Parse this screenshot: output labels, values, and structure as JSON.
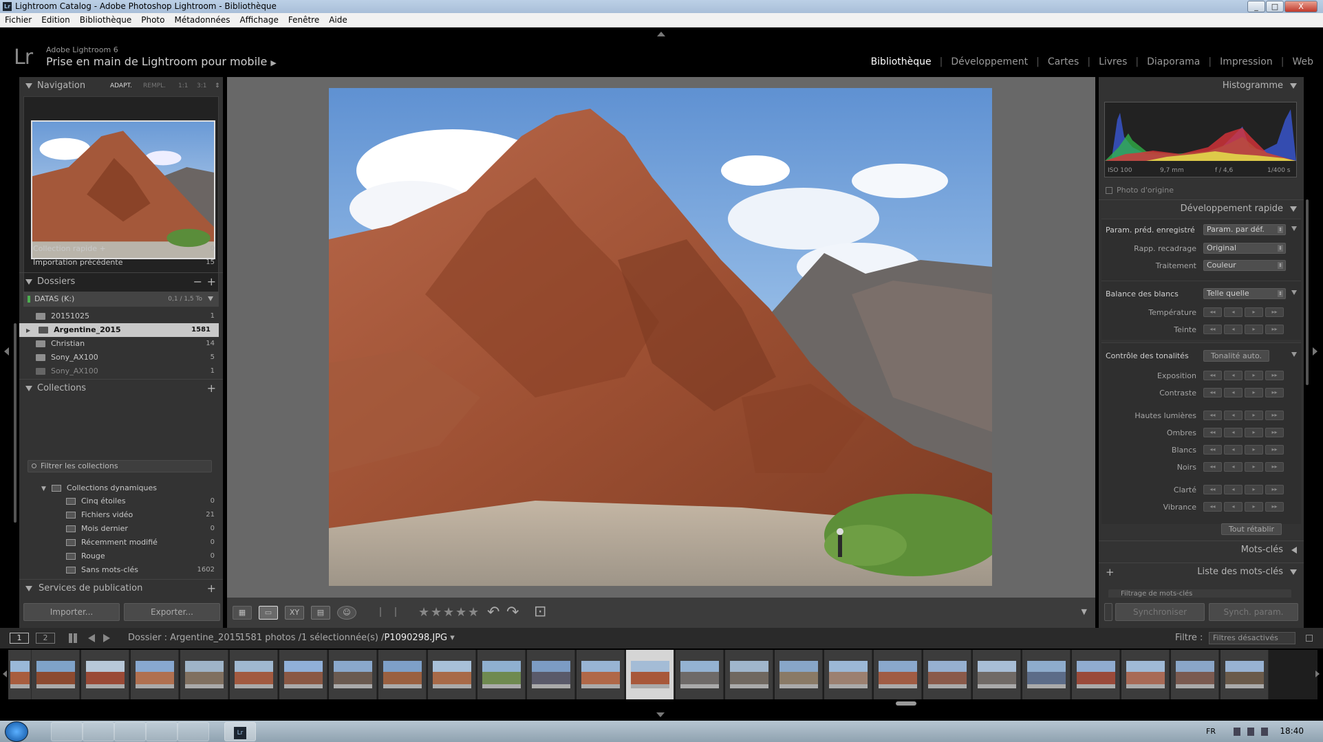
{
  "window": {
    "title": "Lightroom Catalog - Adobe Photoshop Lightroom - Bibliothèque",
    "lr_icon_text": "Lr",
    "min": "_",
    "max": "□",
    "close": "X"
  },
  "menu": [
    "Fichier",
    "Edition",
    "Bibliothèque",
    "Photo",
    "Métadonnées",
    "Affichage",
    "Fenêtre",
    "Aide"
  ],
  "identity": {
    "logo": "Lr",
    "version": "Adobe Lightroom 6",
    "title": "Prise en main de Lightroom pour mobile",
    "title_arrow": "▶"
  },
  "modules": [
    "Bibliothèque",
    "Développement",
    "Cartes",
    "Livres",
    "Diaporama",
    "Impression",
    "Web"
  ],
  "navigation": {
    "title": "Navigation",
    "zoom": [
      "ADAPT.",
      "REMPL.",
      "1:1",
      "3:1"
    ],
    "zoom_arrows": "⇕"
  },
  "catalog": [
    {
      "label": "Collection rapide +",
      "count": "0"
    },
    {
      "label": "Importation précédente",
      "count": "15"
    }
  ],
  "folders": {
    "title": "Dossiers",
    "minus": "−",
    "plus": "+",
    "volume": {
      "name": "DATAS (K:)",
      "space": "0,1 / 1,5 To"
    },
    "items": [
      {
        "label": "20151025",
        "count": "1"
      },
      {
        "label": "Argentine_2015",
        "count": "1581"
      },
      {
        "label": "Christian",
        "count": "14"
      },
      {
        "label": "Sony_AX100",
        "count": "5"
      },
      {
        "label": "Sony_AX100",
        "count": "1"
      }
    ]
  },
  "collections": {
    "title": "Collections",
    "plus": "+",
    "filter_placeholder": "Filtrer les collections",
    "group": "Collections dynamiques",
    "items": [
      {
        "label": "Cinq étoiles",
        "count": "0"
      },
      {
        "label": "Fichiers vidéo",
        "count": "21"
      },
      {
        "label": "Mois dernier",
        "count": "0"
      },
      {
        "label": "Récemment modifié",
        "count": "0"
      },
      {
        "label": "Rouge",
        "count": "0"
      },
      {
        "label": "Sans mots-clés",
        "count": "1602"
      }
    ]
  },
  "publish": {
    "title": "Services de publication",
    "plus": "+"
  },
  "left_buttons": {
    "import": "Importer...",
    "export": "Exporter..."
  },
  "histogram": {
    "title": "Histogramme",
    "iso": "ISO 100",
    "focal": "9,7 mm",
    "aperture": "f / 4,6",
    "shutter": "1/400 s",
    "original": "Photo d'origine"
  },
  "quick_develop": {
    "title": "Développement rapide",
    "preset_label": "Param. préd. enregistré",
    "preset_value": "Param. par déf.",
    "crop_label": "Rapp. recadrage",
    "crop_value": "Original",
    "treatment_label": "Traitement",
    "treatment_value": "Couleur",
    "wb_label": "Balance des blancs",
    "wb_value": "Telle quelle",
    "temp_label": "Température",
    "tint_label": "Teinte",
    "tone_label": "Contrôle des tonalités",
    "auto_tone": "Tonalité auto.",
    "exposure": "Exposition",
    "contrast": "Contraste",
    "highlights": "Hautes lumières",
    "shadows": "Ombres",
    "whites": "Blancs",
    "blacks": "Noirs",
    "clarity": "Clarté",
    "vibrance": "Vibrance",
    "reset": "Tout rétablir",
    "step_ll": "◂◂",
    "step_l": "◂",
    "step_r": "▸",
    "step_rr": "▸▸"
  },
  "keywords": {
    "title": "Mots-clés",
    "list_title": "Liste des mots-clés",
    "plus": "+",
    "filter": "Filtrage de mots-clés"
  },
  "right_buttons": {
    "sync": "Synchroniser",
    "sync_params": "Synch. param."
  },
  "toolbar": {
    "grid": "▦",
    "loupe": "▭",
    "compare": "XY",
    "survey": "▤",
    "people": "☺",
    "stars": [
      "★",
      "★",
      "★",
      "★",
      "★"
    ],
    "rotate_l": "↶",
    "rotate_r": "↷",
    "crop": "⊡",
    "more": "▼"
  },
  "filmbar": {
    "screen1": "1",
    "screen2": "2",
    "source": "Dossier : Argentine_2015",
    "info": "1581 photos /1 sélectionnée(s) /",
    "file": "P1090298.JPG",
    "file_arrow": "▾",
    "filter_label": "Filtre :",
    "filter_value": "Filtres désactivés"
  },
  "taskbar": {
    "lang": "FR",
    "time": "18:40",
    "lr_item": "Lr"
  }
}
